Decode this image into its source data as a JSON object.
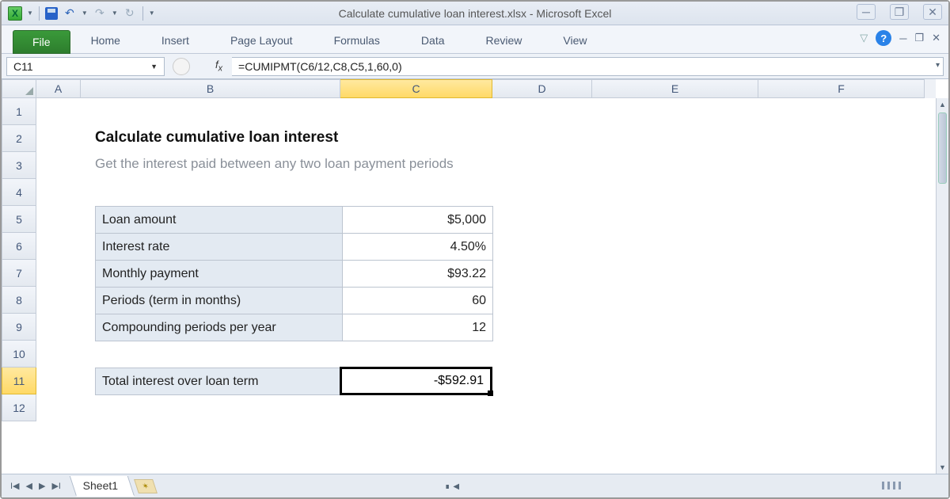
{
  "app": {
    "title": "Calculate cumulative loan interest.xlsx  -  Microsoft Excel"
  },
  "ribbon": {
    "file": "File",
    "tabs": [
      "Home",
      "Insert",
      "Page Layout",
      "Formulas",
      "Data",
      "Review",
      "View"
    ]
  },
  "namebox": "C11",
  "formula": "=CUMIPMT(C6/12,C8,C5,1,60,0)",
  "columns": [
    "A",
    "B",
    "C",
    "D",
    "E",
    "F"
  ],
  "rows": [
    "1",
    "2",
    "3",
    "4",
    "5",
    "6",
    "7",
    "8",
    "9",
    "10",
    "11",
    "12"
  ],
  "selected_col": "C",
  "selected_row": "11",
  "doc": {
    "title": "Calculate cumulative loan interest",
    "subtitle": "Get the interest paid between any two loan payment periods",
    "rows": [
      {
        "label": "Loan amount",
        "value": "$5,000"
      },
      {
        "label": "Interest rate",
        "value": "4.50%"
      },
      {
        "label": "Monthly payment",
        "value": "$93.22"
      },
      {
        "label": "Periods (term in months)",
        "value": "60"
      },
      {
        "label": "Compounding periods per year",
        "value": "12"
      }
    ],
    "result_label": "Total interest over loan term",
    "result_value": "-$592.91"
  },
  "sheet": {
    "active": "Sheet1"
  },
  "chart_data": {
    "type": "table",
    "title": "Calculate cumulative loan interest",
    "series": [
      {
        "name": "Loan amount",
        "values": [
          5000
        ]
      },
      {
        "name": "Interest rate",
        "values": [
          0.045
        ]
      },
      {
        "name": "Monthly payment",
        "values": [
          93.22
        ]
      },
      {
        "name": "Periods (term in months)",
        "values": [
          60
        ]
      },
      {
        "name": "Compounding periods per year",
        "values": [
          12
        ]
      },
      {
        "name": "Total interest over loan term",
        "values": [
          -592.91
        ]
      }
    ]
  }
}
